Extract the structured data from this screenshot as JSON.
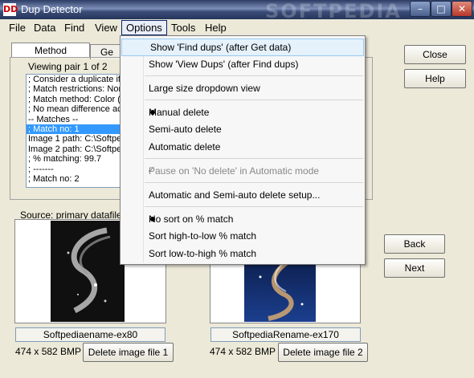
{
  "window": {
    "title": "Dup Detector",
    "icon_text": "DD",
    "watermark": "SOFTPEDIA",
    "minimize": "–",
    "maximize": "□",
    "close": "✕"
  },
  "menubar": [
    "File",
    "Data",
    "Find",
    "View",
    "Options",
    "Tools",
    "Help"
  ],
  "tabs": {
    "method": "Method",
    "general": "Ge"
  },
  "viewing": "Viewing pair 1 of 2",
  "list_rows": [
    "; Consider a duplicate if",
    "; Match restrictions: Nor",
    "; Match method: Color (e",
    "; No mean difference ac",
    "-- Matches --",
    "; Match no: 1",
    "Image 1 path: C:\\Softpe",
    "Image 2 path: C:\\Softpe",
    "; % matching: 99.7",
    "; -------",
    "; Match no: 2"
  ],
  "buttons": {
    "close": "Close",
    "help": "Help",
    "back": "Back",
    "next": "Next",
    "delete1": "Delete image file 1",
    "delete2": "Delete image file 2"
  },
  "source_label": "Source: primary datafile",
  "image1": {
    "name": "Softpediaename-ex80",
    "info": "474 x 582 BMP"
  },
  "image2": {
    "name": "SoftpediaRename-ex170",
    "info": "474 x 582 BMP"
  },
  "options_menu": {
    "find_dups": "Show 'Find dups' (after Get data)",
    "view_dups": "Show 'View Dups' (after Find dups)",
    "large_dropdown": "Large size dropdown view",
    "manual_delete": "Manual delete",
    "semi_auto_delete": "Semi-auto delete",
    "automatic_delete": "Automatic delete",
    "pause_no_delete": "Pause on 'No delete' in Automatic mode",
    "auto_setup": "Automatic and Semi-auto delete setup...",
    "no_sort": "No sort on % match",
    "sort_high_low": "Sort high-to-low % match",
    "sort_low_high": "Sort low-to-high % match"
  },
  "colors": {
    "title_bar": "#2d3c64",
    "selection": "#3399ff",
    "menu_highlight": "#e5f1fb",
    "window_bg": "#ece9d8"
  }
}
